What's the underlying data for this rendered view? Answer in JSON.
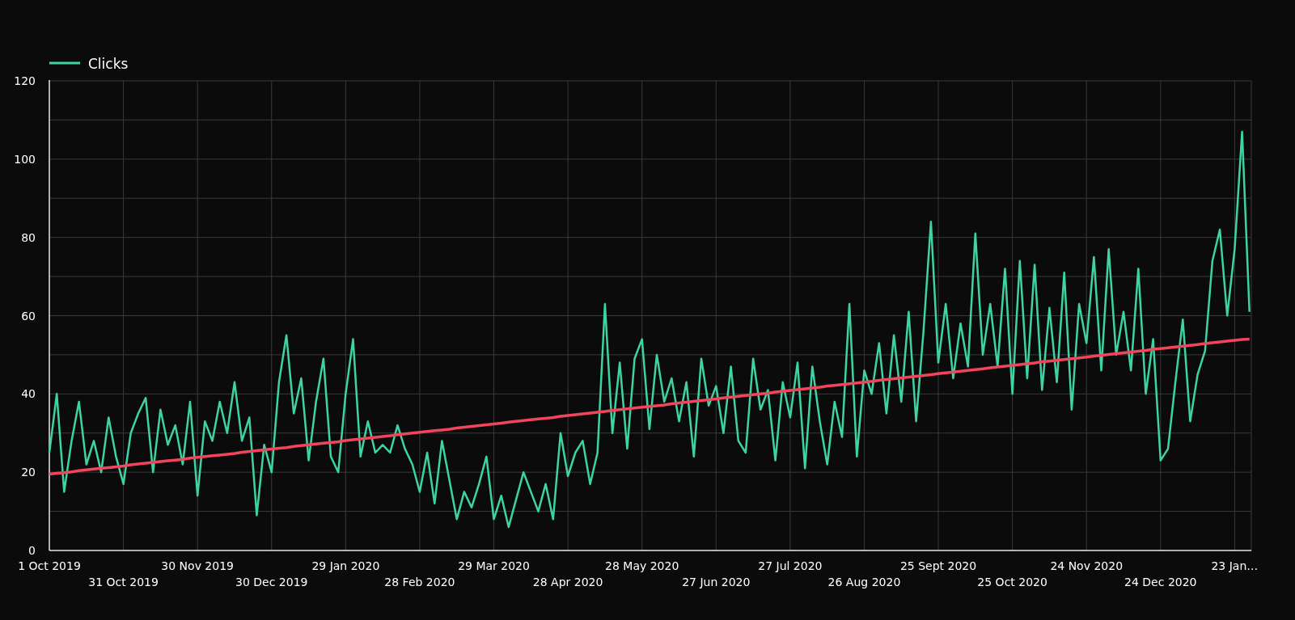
{
  "chart": {
    "chart_data": {
      "type": "line",
      "categories": [
        "1 Oct 2019",
        null,
        null,
        null,
        null,
        null,
        null,
        null,
        null,
        null,
        "31 Oct 2019",
        null,
        null,
        null,
        null,
        null,
        null,
        null,
        null,
        null,
        "30 Nov 2019",
        null,
        null,
        null,
        null,
        null,
        null,
        null,
        null,
        null,
        "30 Dec 2019",
        null,
        null,
        null,
        null,
        null,
        null,
        null,
        null,
        null,
        "29 Jan 2020",
        null,
        null,
        null,
        null,
        null,
        null,
        null,
        null,
        null,
        "28 Feb 2020",
        null,
        null,
        null,
        null,
        null,
        null,
        null,
        null,
        null,
        "29 Mar 2020",
        null,
        null,
        null,
        null,
        null,
        null,
        null,
        null,
        null,
        "28 Apr 2020",
        null,
        null,
        null,
        null,
        null,
        null,
        null,
        null,
        null,
        "28 May 2020",
        null,
        null,
        null,
        null,
        null,
        null,
        null,
        null,
        null,
        "27 Jun 2020",
        null,
        null,
        null,
        null,
        null,
        null,
        null,
        null,
        null,
        "27 Jul 2020",
        null,
        null,
        null,
        null,
        null,
        null,
        null,
        null,
        null,
        "26 Aug 2020",
        null,
        null,
        null,
        null,
        null,
        null,
        null,
        null,
        null,
        "25 Sept 2020",
        null,
        null,
        null,
        null,
        null,
        null,
        null,
        null,
        null,
        "25 Oct 2020",
        null,
        null,
        null,
        null,
        null,
        null,
        null,
        null,
        null,
        "24 Nov 2020",
        null,
        null,
        null,
        null,
        null,
        null,
        null,
        null,
        null,
        "24 Dec 2020",
        null,
        null,
        null,
        null,
        null,
        null,
        null,
        null,
        null,
        "23 Jan…",
        null,
        null
      ],
      "series": [
        {
          "name": "Clicks",
          "color": "#3ed3a3",
          "values": [
            25,
            40,
            15,
            28,
            38,
            22,
            28,
            20,
            34,
            24,
            17,
            30,
            35,
            39,
            20,
            36,
            27,
            32,
            22,
            38,
            14,
            33,
            28,
            38,
            30,
            43,
            28,
            34,
            9,
            27,
            20,
            43,
            55,
            35,
            44,
            23,
            38,
            49,
            24,
            20,
            40,
            54,
            24,
            33,
            25,
            27,
            25,
            32,
            26,
            22,
            15,
            25,
            12,
            28,
            18,
            8,
            15,
            11,
            17,
            24,
            8,
            14,
            6,
            13,
            20,
            15,
            10,
            17,
            8,
            30,
            19,
            25,
            28,
            17,
            25,
            63,
            30,
            48,
            26,
            49,
            54,
            31,
            50,
            38,
            44,
            33,
            43,
            24,
            49,
            37,
            42,
            30,
            47,
            28,
            25,
            49,
            36,
            41,
            23,
            43,
            34,
            48,
            21,
            47,
            33,
            22,
            38,
            29,
            63,
            24,
            46,
            40,
            53,
            35,
            55,
            38,
            61,
            33,
            56,
            84,
            48,
            63,
            44,
            58,
            47,
            81,
            50,
            63,
            47,
            72,
            40,
            74,
            44,
            73,
            41,
            62,
            43,
            71,
            36,
            63,
            53,
            75,
            46,
            77,
            50,
            61,
            46,
            72,
            40,
            54,
            23,
            26,
            43,
            59,
            33,
            45,
            51,
            74,
            82,
            60,
            77,
            107,
            61
          ]
        },
        {
          "color": "#f2455b",
          "values": [
            19.5,
            19.7,
            19.9,
            20.1,
            20.4,
            20.6,
            20.8,
            21.0,
            21.2,
            21.4,
            21.6,
            21.9,
            22.1,
            22.3,
            22.5,
            22.7,
            22.9,
            23.1,
            23.3,
            23.6,
            23.8,
            24.0,
            24.2,
            24.4,
            24.6,
            24.8,
            25.1,
            25.3,
            25.5,
            25.7,
            25.9,
            26.1,
            26.3,
            26.6,
            26.8,
            27.0,
            27.2,
            27.4,
            27.6,
            27.8,
            28.1,
            28.3,
            28.5,
            28.7,
            28.9,
            29.1,
            29.3,
            29.6,
            29.8,
            30.0,
            30.2,
            30.4,
            30.6,
            30.8,
            31.0,
            31.3,
            31.5,
            31.7,
            31.9,
            32.1,
            32.3,
            32.5,
            32.8,
            33.0,
            33.2,
            33.4,
            33.6,
            33.8,
            34.0,
            34.3,
            34.5,
            34.7,
            34.9,
            35.1,
            35.3,
            35.5,
            35.8,
            36.0,
            36.2,
            36.4,
            36.6,
            36.8,
            37.0,
            37.2,
            37.5,
            37.7,
            37.9,
            38.1,
            38.3,
            38.5,
            38.7,
            39.0,
            39.2,
            39.4,
            39.6,
            39.8,
            40.0,
            40.2,
            40.5,
            40.7,
            40.9,
            41.1,
            41.3,
            41.5,
            41.7,
            42.0,
            42.2,
            42.4,
            42.6,
            42.8,
            43.0,
            43.2,
            43.5,
            43.7,
            43.9,
            44.1,
            44.3,
            44.5,
            44.7,
            44.9,
            45.2,
            45.4,
            45.6,
            45.8,
            46.0,
            46.2,
            46.4,
            46.7,
            46.9,
            47.1,
            47.3,
            47.5,
            47.7,
            47.9,
            48.2,
            48.4,
            48.6,
            48.8,
            49.0,
            49.2,
            49.4,
            49.7,
            49.9,
            50.1,
            50.3,
            50.5,
            50.7,
            50.9,
            51.1,
            51.4,
            51.6,
            51.8,
            52.0,
            52.2,
            52.4,
            52.6,
            52.9,
            53.1,
            53.3,
            53.5,
            53.7,
            53.9,
            54.0
          ]
        }
      ],
      "grid": true,
      "ylim": [
        0,
        120
      ],
      "yticks": [
        0,
        20,
        40,
        60,
        80,
        100,
        120
      ]
    }
  }
}
